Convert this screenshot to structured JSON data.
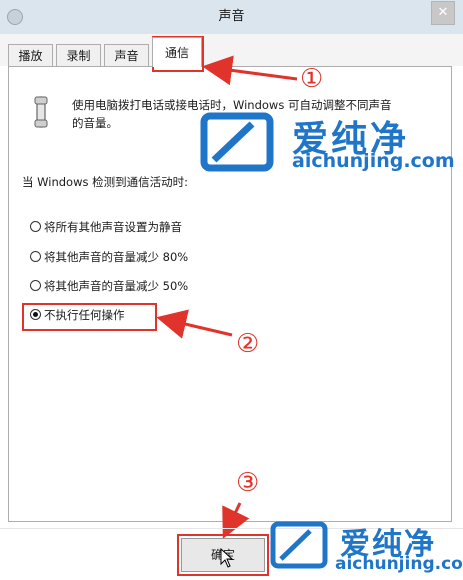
{
  "window": {
    "title": "声音",
    "close_glyph": "✕"
  },
  "tabs": [
    {
      "label": "播放"
    },
    {
      "label": "录制"
    },
    {
      "label": "声音"
    },
    {
      "label": "通信",
      "active": true
    }
  ],
  "description": "使用电脑拨打电话或接电话时，Windows 可自动调整不同声音的音量。",
  "detect_label": "当 Windows 检测到通信活动时:",
  "options": [
    {
      "label": "将所有其他声音设置为静音",
      "selected": false
    },
    {
      "label": "将其他声音的音量减少 80%",
      "selected": false
    },
    {
      "label": "将其他声音的音量减少 50%",
      "selected": false
    },
    {
      "label": "不执行任何操作",
      "selected": true
    }
  ],
  "ok_button": {
    "label": "确定"
  },
  "annotations": {
    "step1": "①",
    "step2": "②",
    "step3": "③",
    "color": "#e0332b"
  },
  "watermark": {
    "name": "爱纯净",
    "url": "aichunjing.com",
    "color": "#1f76c9"
  }
}
